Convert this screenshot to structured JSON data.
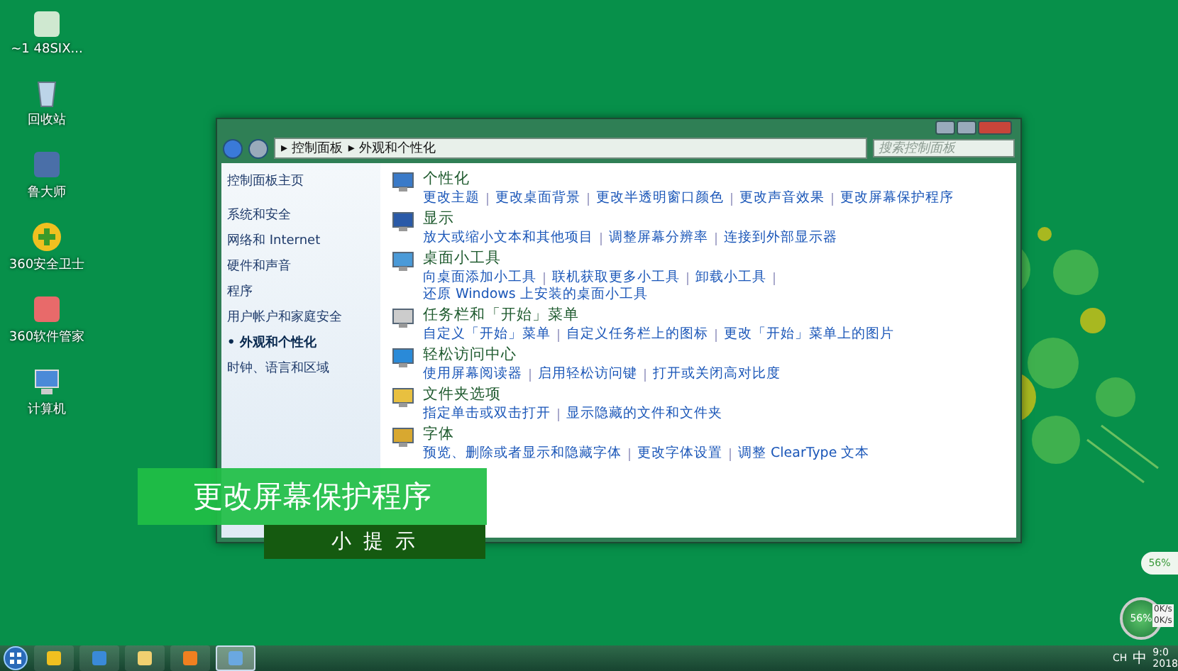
{
  "desktop_icons": [
    {
      "label": "~1 48SIX...",
      "kind": "file"
    },
    {
      "label": "回收站",
      "kind": "bin"
    },
    {
      "label": "鲁大师",
      "kind": "app"
    },
    {
      "label": "360安全卫士",
      "kind": "shield"
    },
    {
      "label": "360软件管家",
      "kind": "store"
    },
    {
      "label": "计算机",
      "kind": "computer"
    }
  ],
  "window": {
    "breadcrumb": [
      "控制面板",
      "外观和个性化"
    ],
    "breadcrumb_separator": "▸",
    "search": {
      "placeholder": "搜索控制面板"
    },
    "sidebar": {
      "home": "控制面板主页",
      "marker": "•",
      "items": [
        {
          "label": "系统和安全",
          "selected": false
        },
        {
          "label": "网络和 Internet",
          "selected": false
        },
        {
          "label": "硬件和声音",
          "selected": false
        },
        {
          "label": "程序",
          "selected": false
        },
        {
          "label": "用户帐户和家庭安全",
          "selected": false
        },
        {
          "label": "外观和个性化",
          "selected": true
        },
        {
          "label": "时钟、语言和区域",
          "selected": false
        }
      ]
    },
    "sections": [
      {
        "title": "个性化",
        "kind": "personalize",
        "links": [
          "更改主题",
          "更改桌面背景",
          "更改半透明窗口颜色",
          "更改声音效果",
          "更改屏幕保护程序"
        ]
      },
      {
        "title": "显示",
        "kind": "display",
        "links": [
          "放大或缩小文本和其他项目",
          "调整屏幕分辨率",
          "连接到外部显示器"
        ]
      },
      {
        "title": "桌面小工具",
        "kind": "gadget",
        "links": [
          "向桌面添加小工具",
          "联机获取更多小工具",
          "卸载小工具",
          "还原 Windows 上安装的桌面小工具"
        ]
      },
      {
        "title": "任务栏和「开始」菜单",
        "kind": "taskbar",
        "links": [
          "自定义「开始」菜单",
          "自定义任务栏上的图标",
          "更改「开始」菜单上的图片"
        ]
      },
      {
        "title": "轻松访问中心",
        "kind": "access",
        "links": [
          "使用屏幕阅读器",
          "启用轻松访问键",
          "打开或关闭高对比度"
        ]
      },
      {
        "title": "文件夹选项",
        "kind": "folder",
        "links": [
          "指定单击或双击打开",
          "显示隐藏的文件和文件夹"
        ]
      },
      {
        "title": "字体",
        "kind": "font",
        "links": [
          "预览、删除或者显示和隐藏字体",
          "更改字体设置",
          "调整 ClearType 文本"
        ]
      }
    ]
  },
  "captions": [
    {
      "text": "更改屏幕保护程序",
      "kind": "title"
    },
    {
      "text": "小 提 示",
      "kind": "subtitle"
    }
  ],
  "gadgets": {
    "memory": "56%",
    "ball": "56%",
    "speeds": [
      "0K/s",
      "0K/s"
    ]
  },
  "taskbar": {
    "apps": [
      {
        "kind": "shield",
        "selected": false
      },
      {
        "kind": "ie",
        "selected": false
      },
      {
        "kind": "folder",
        "selected": false
      },
      {
        "kind": "media",
        "selected": false
      },
      {
        "kind": "panel",
        "selected": true
      }
    ],
    "tray": {
      "lang": "CH",
      "ime": "中",
      "time": "9:0",
      "date": "2018"
    }
  }
}
